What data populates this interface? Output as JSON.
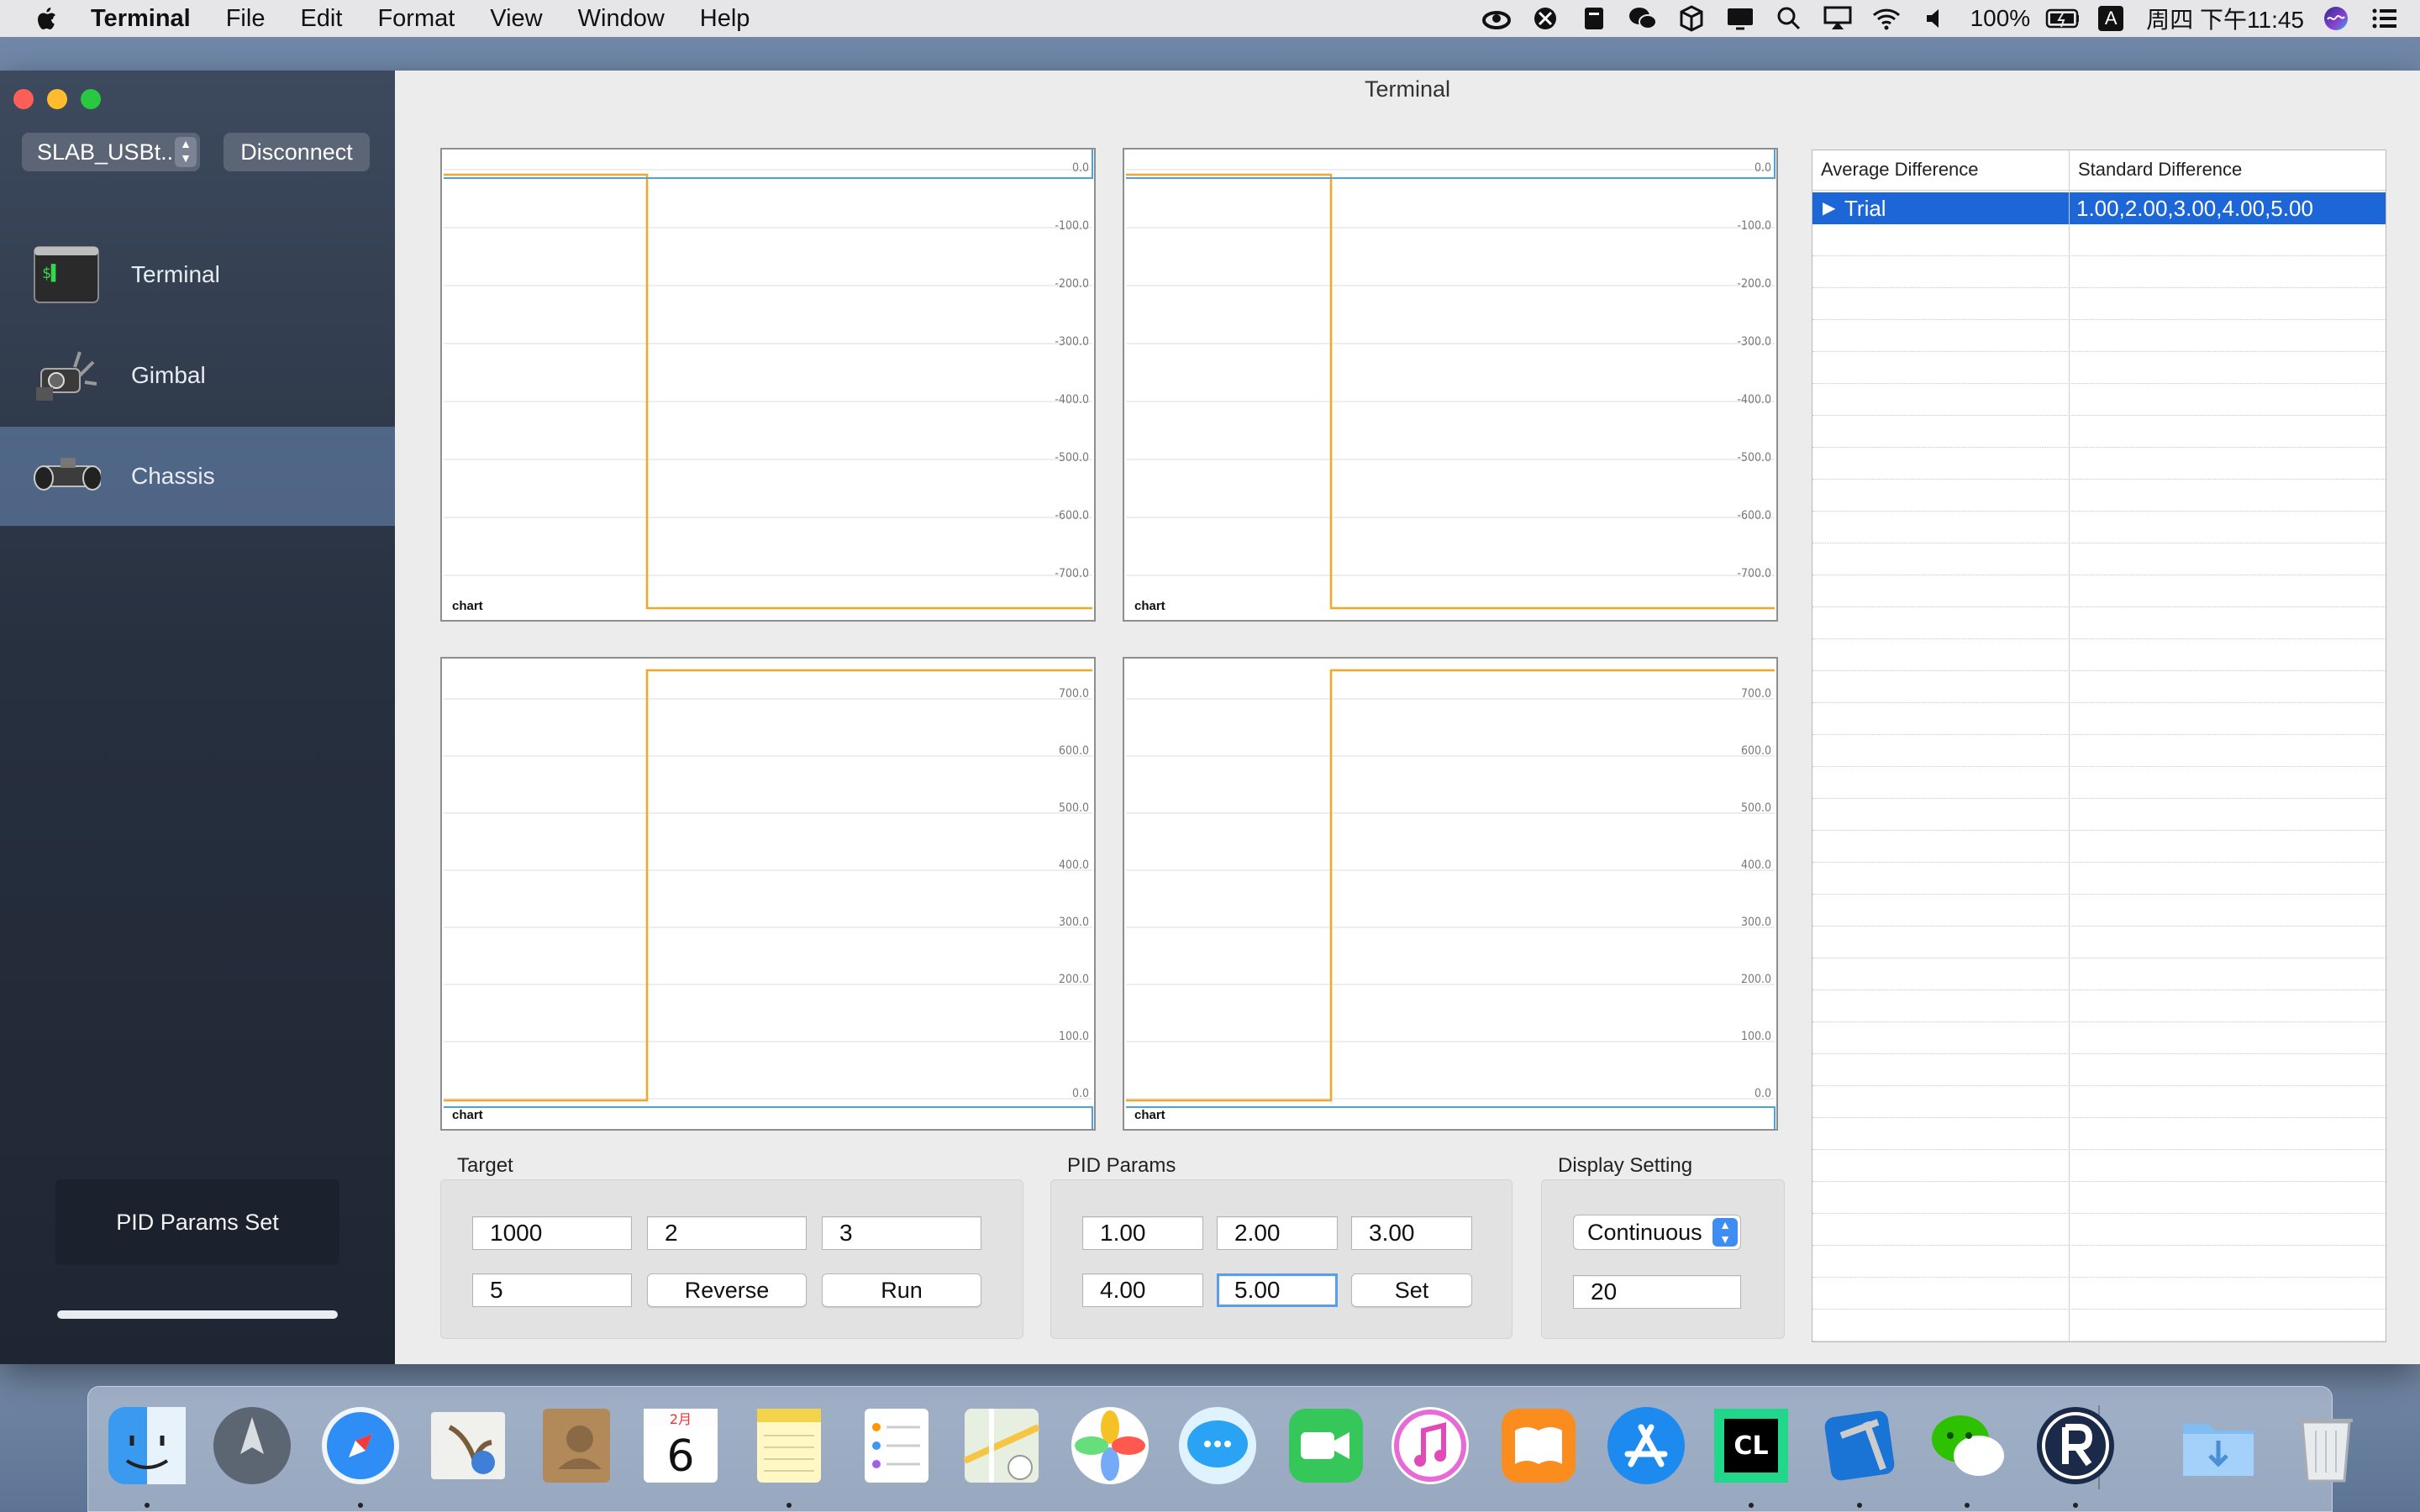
{
  "menubar": {
    "app_name": "Terminal",
    "items": [
      "File",
      "Edit",
      "Format",
      "View",
      "Window",
      "Help"
    ],
    "battery": "100%",
    "input_method": "A",
    "datetime": "周四 下午11:45"
  },
  "window": {
    "title": "Terminal"
  },
  "sidebar": {
    "port": "SLAB_USBt...",
    "disconnect_label": "Disconnect",
    "nav": [
      {
        "label": "Terminal",
        "icon": "terminal-icon",
        "selected": false
      },
      {
        "label": "Gimbal",
        "icon": "gimbal-icon",
        "selected": false
      },
      {
        "label": "Chassis",
        "icon": "chassis-icon",
        "selected": true
      }
    ],
    "status_box": "PID Params Set",
    "progress": 1.0
  },
  "charts": [
    {
      "label": "chart",
      "ticks": [
        "0.0",
        "-100.0",
        "-200.0",
        "-300.0",
        "-400.0",
        "-500.0",
        "-600.0",
        "-700.0"
      ]
    },
    {
      "label": "chart",
      "ticks": [
        "0.0",
        "-100.0",
        "-200.0",
        "-300.0",
        "-400.0",
        "-500.0",
        "-600.0",
        "-700.0"
      ]
    },
    {
      "label": "chart",
      "ticks": [
        "700.0",
        "600.0",
        "500.0",
        "400.0",
        "300.0",
        "200.0",
        "100.0",
        "0.0"
      ]
    },
    {
      "label": "chart",
      "ticks": [
        "700.0",
        "600.0",
        "500.0",
        "400.0",
        "300.0",
        "200.0",
        "100.0",
        "0.0"
      ]
    }
  ],
  "chart_data": [
    {
      "type": "line",
      "ylim": [
        -750,
        0
      ],
      "series": [
        {
          "color": "#f5a623",
          "shape": "step-down",
          "from": 0,
          "to": -750
        },
        {
          "color": "#4aa3e0",
          "shape": "flat",
          "value": 0
        }
      ]
    },
    {
      "type": "line",
      "ylim": [
        -750,
        0
      ],
      "series": [
        {
          "color": "#f5a623",
          "shape": "step-down",
          "from": 0,
          "to": -750
        },
        {
          "color": "#4aa3e0",
          "shape": "flat",
          "value": 0
        }
      ]
    },
    {
      "type": "line",
      "ylim": [
        0,
        750
      ],
      "series": [
        {
          "color": "#f5a623",
          "shape": "step-up",
          "from": 0,
          "to": 750
        },
        {
          "color": "#4aa3e0",
          "shape": "flat",
          "value": 0
        }
      ]
    },
    {
      "type": "line",
      "ylim": [
        0,
        750
      ],
      "series": [
        {
          "color": "#f5a623",
          "shape": "step-up",
          "from": 0,
          "to": 750
        },
        {
          "color": "#4aa3e0",
          "shape": "flat",
          "value": 0
        }
      ]
    }
  ],
  "target": {
    "title": "Target",
    "field1": "1000",
    "field2": "2",
    "field3": "3",
    "field4": "5",
    "reverse_label": "Reverse",
    "run_label": "Run"
  },
  "pid": {
    "title": "PID Params",
    "p1": "1.00",
    "p2": "2.00",
    "p3": "3.00",
    "p4": "4.00",
    "p5": "5.00",
    "set_label": "Set"
  },
  "display": {
    "title": "Display Setting",
    "mode": "Continuous",
    "value": "20"
  },
  "table": {
    "col1": "Average Difference",
    "col2": "Standard Difference",
    "row_name": "Trial",
    "row_value": "1.00,2.00,3.00,4.00,5.00"
  },
  "dock": {
    "apps": [
      "finder-icon",
      "launchpad-icon",
      "safari-icon",
      "mail-icon",
      "contacts-icon",
      "calendar-icon",
      "notes-icon",
      "reminders-icon",
      "maps-icon",
      "photos-icon",
      "messages-icon",
      "facetime-icon",
      "itunes-icon",
      "books-icon",
      "app-store-icon",
      "clion-icon",
      "xcode-icon",
      "wechat-icon",
      "robomaster-icon",
      "downloads-folder-icon",
      "trash-icon"
    ],
    "calendar_month": "2月",
    "calendar_day": "6",
    "clion_text": "CL"
  },
  "colors": {
    "accent": "#1c66d7",
    "orange_series": "#f5a623",
    "blue_series": "#4aa3e0"
  }
}
